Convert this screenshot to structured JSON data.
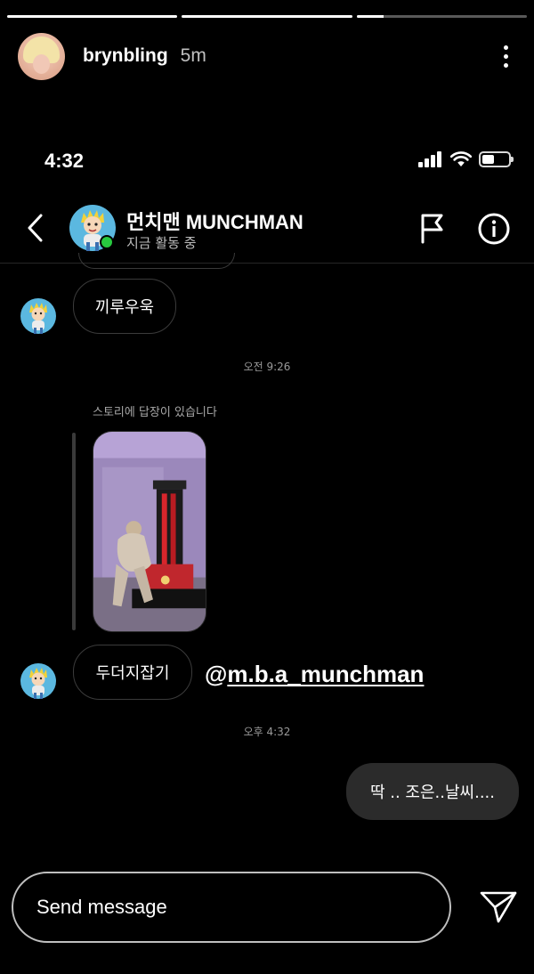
{
  "story": {
    "progress": [
      1.0,
      1.0,
      0.16
    ],
    "username": "brynbling",
    "time_ago": "5m"
  },
  "status_bar": {
    "time": "4:32",
    "battery_level": 0.45
  },
  "chat": {
    "name": "먼치맨 MUNCHMAN",
    "activity": "지금 활동 중",
    "online_color": "#27c93f"
  },
  "messages": {
    "msg1": "끼루우욱",
    "timestamp1": "오전 9:26",
    "story_reply_label": "스토리에 답장이 있습니다",
    "msg2": "두더지잡기",
    "timestamp2": "오후 4:32",
    "outgoing": "딱 .. 조은..날씨...."
  },
  "mention": {
    "at": "@",
    "handle": "m.b.a_munchman"
  },
  "composer": {
    "placeholder": "Send message"
  },
  "icons": {
    "back": "chevron-left-icon",
    "flag": "flag-icon",
    "info": "info-icon",
    "send": "send-icon",
    "more": "more-vertical-icon"
  }
}
